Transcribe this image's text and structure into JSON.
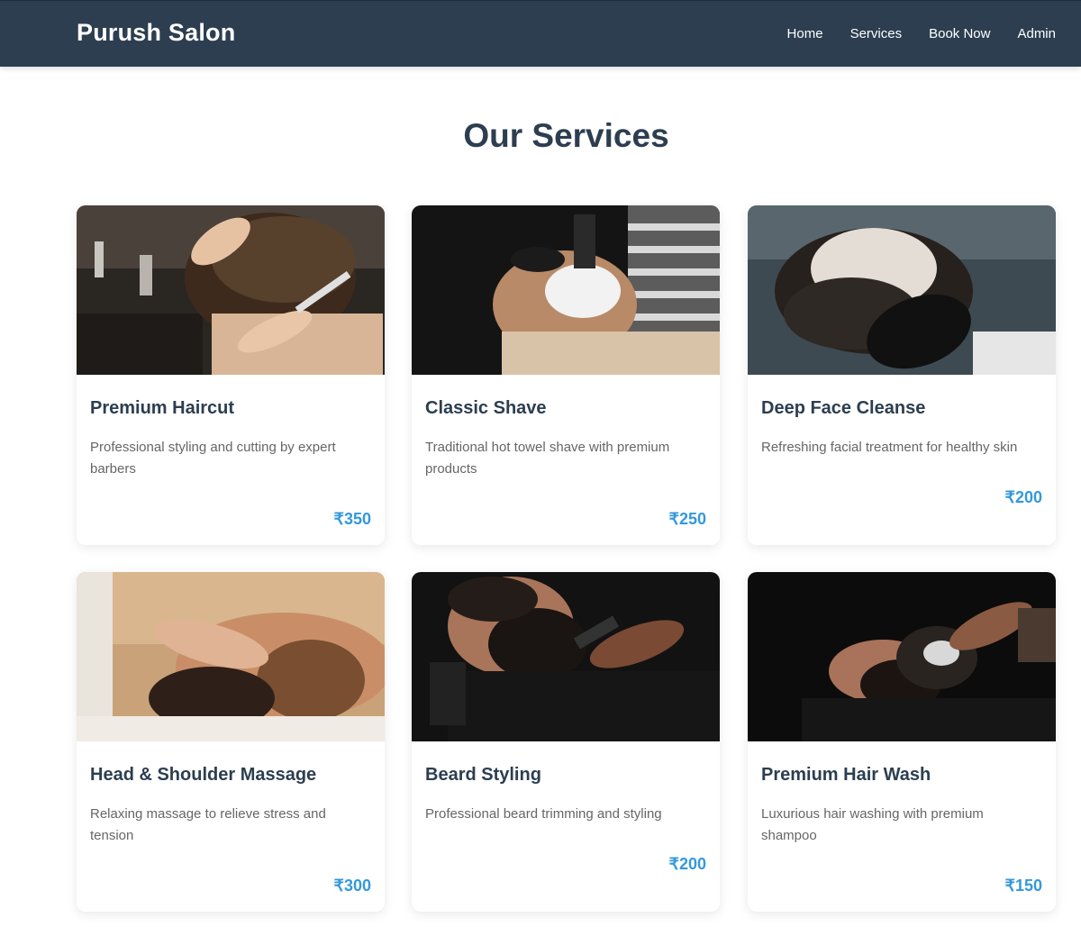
{
  "brand": {
    "name": "Purush Salon"
  },
  "nav": {
    "items": [
      {
        "label": "Home"
      },
      {
        "label": "Services"
      },
      {
        "label": "Book Now"
      },
      {
        "label": "Admin"
      }
    ]
  },
  "page": {
    "title": "Our Services"
  },
  "services": [
    {
      "title": "Premium Haircut",
      "description": "Professional styling and cutting by expert barbers",
      "price": "₹350",
      "image": "haircut-photo"
    },
    {
      "title": "Classic Shave",
      "description": "Traditional hot towel shave with premium products",
      "price": "₹250",
      "image": "shave-photo"
    },
    {
      "title": "Deep Face Cleanse",
      "description": "Refreshing facial treatment for healthy skin",
      "price": "₹200",
      "image": "facial-photo"
    },
    {
      "title": "Head & Shoulder Massage",
      "description": "Relaxing massage to relieve stress and tension",
      "price": "₹300",
      "image": "massage-photo"
    },
    {
      "title": "Beard Styling",
      "description": "Professional beard trimming and styling",
      "price": "₹200",
      "image": "beard-photo"
    },
    {
      "title": "Premium Hair Wash",
      "description": "Luxurious hair washing with premium shampoo",
      "price": "₹150",
      "image": "hairwash-photo"
    }
  ],
  "colors": {
    "navbar": "#2c3e50",
    "heading": "#2c3e50",
    "price": "#3498db",
    "description": "#666666"
  }
}
